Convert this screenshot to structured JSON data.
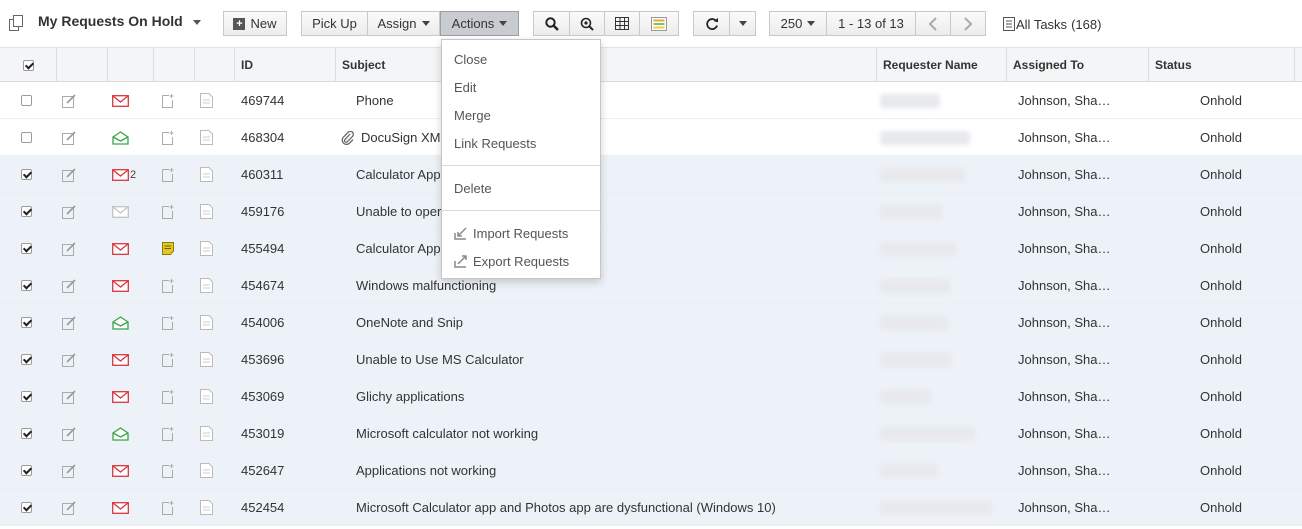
{
  "view": {
    "title": "My Requests On Hold"
  },
  "toolbar": {
    "new_label": "New",
    "pickup_label": "Pick Up",
    "assign_label": "Assign",
    "actions_label": "Actions",
    "page_size": "250",
    "range": "1 - 13 of 13",
    "all_tasks": "All Tasks",
    "all_tasks_count": "(168)"
  },
  "actions_menu": {
    "close": "Close",
    "edit": "Edit",
    "merge": "Merge",
    "link": "Link Requests",
    "delete": "Delete",
    "import": "Import Requests",
    "export": "Export Requests"
  },
  "columns": {
    "id": "ID",
    "subject": "Subject",
    "requester": "Requester Name",
    "assigned": "Assigned To",
    "status": "Status"
  },
  "colors": {
    "mail_red": "#d9363e",
    "mail_green": "#3aa346",
    "row_selected": "#edf2f8",
    "note_yellow": "#e3c91f"
  },
  "rows": [
    {
      "id": "469744",
      "subject": "Phone",
      "assigned": "Johnson, Sha…",
      "status": "Onhold",
      "checked": false,
      "mail": "red",
      "mail_count": "",
      "note": false,
      "attach": false
    },
    {
      "id": "468304",
      "subject": "DocuSign XM",
      "assigned": "Johnson, Sha…",
      "status": "Onhold",
      "checked": false,
      "mail": "green",
      "mail_count": "",
      "note": false,
      "attach": true
    },
    {
      "id": "460311",
      "subject": "Calculator App",
      "assigned": "Johnson, Sha…",
      "status": "Onhold",
      "checked": true,
      "mail": "red",
      "mail_count": "2",
      "note": false,
      "attach": false
    },
    {
      "id": "459176",
      "subject": "Unable to oper",
      "assigned": "Johnson, Sha…",
      "status": "Onhold",
      "checked": true,
      "mail": "grey",
      "mail_count": "",
      "note": false,
      "attach": false
    },
    {
      "id": "455494",
      "subject": "Calculator App",
      "assigned": "Johnson, Sha…",
      "status": "Onhold",
      "checked": true,
      "mail": "red",
      "mail_count": "",
      "note": true,
      "attach": false
    },
    {
      "id": "454674",
      "subject": "Windows malfunctioning",
      "assigned": "Johnson, Sha…",
      "status": "Onhold",
      "checked": true,
      "mail": "red",
      "mail_count": "",
      "note": false,
      "attach": false
    },
    {
      "id": "454006",
      "subject": "OneNote and Snip",
      "assigned": "Johnson, Sha…",
      "status": "Onhold",
      "checked": true,
      "mail": "green",
      "mail_count": "",
      "note": false,
      "attach": false
    },
    {
      "id": "453696",
      "subject": "Unable to Use MS Calculator",
      "assigned": "Johnson, Sha…",
      "status": "Onhold",
      "checked": true,
      "mail": "red",
      "mail_count": "",
      "note": false,
      "attach": false
    },
    {
      "id": "453069",
      "subject": "Glichy applications",
      "assigned": "Johnson, Sha…",
      "status": "Onhold",
      "checked": true,
      "mail": "red",
      "mail_count": "",
      "note": false,
      "attach": false
    },
    {
      "id": "453019",
      "subject": "Microsoft calculator not working",
      "assigned": "Johnson, Sha…",
      "status": "Onhold",
      "checked": true,
      "mail": "green",
      "mail_count": "",
      "note": false,
      "attach": false
    },
    {
      "id": "452647",
      "subject": "Applications not working",
      "assigned": "Johnson, Sha…",
      "status": "Onhold",
      "checked": true,
      "mail": "red",
      "mail_count": "",
      "note": false,
      "attach": false
    },
    {
      "id": "452454",
      "subject": "Microsoft Calculator app and Photos app are dysfunctional (Windows 10)",
      "assigned": "Johnson, Sha…",
      "status": "Onhold",
      "checked": true,
      "mail": "red",
      "mail_count": "",
      "note": false,
      "attach": false
    }
  ]
}
